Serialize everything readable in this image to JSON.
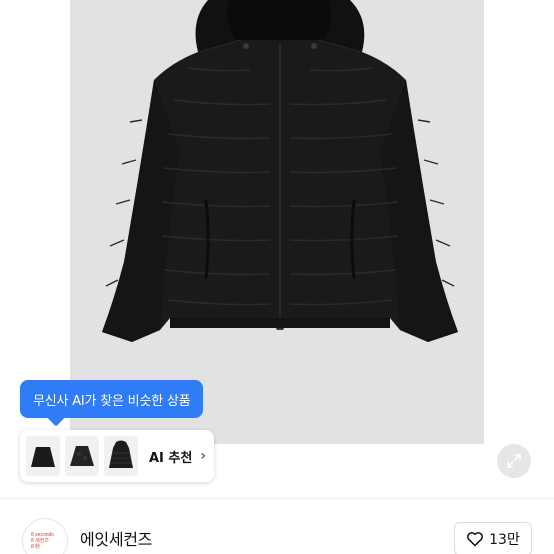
{
  "product": {
    "image_alt": "black hooded padded jacket",
    "bg_color": "#e2e2e4",
    "jacket_color": "#1a1a1b"
  },
  "ai": {
    "tooltip_text": "무신사 AI가 찾은 비슷한 상품",
    "recommend_label": "AI 추천",
    "thumbnails": [
      "black fleece jacket",
      "black boucle jacket",
      "black hooded puffer jacket"
    ],
    "accent_color": "#2f7cf6"
  },
  "brand": {
    "name": "에잇세컨즈",
    "logo_lines": [
      "8 seconds",
      "8 세컨즈",
      "8 秒"
    ],
    "logo_color": "#e03a2f"
  },
  "like": {
    "icon": "heart-outline-icon",
    "count": "13만"
  },
  "icons": {
    "expand": "expand-arrows-icon",
    "chevron": "chevron-right-icon"
  }
}
